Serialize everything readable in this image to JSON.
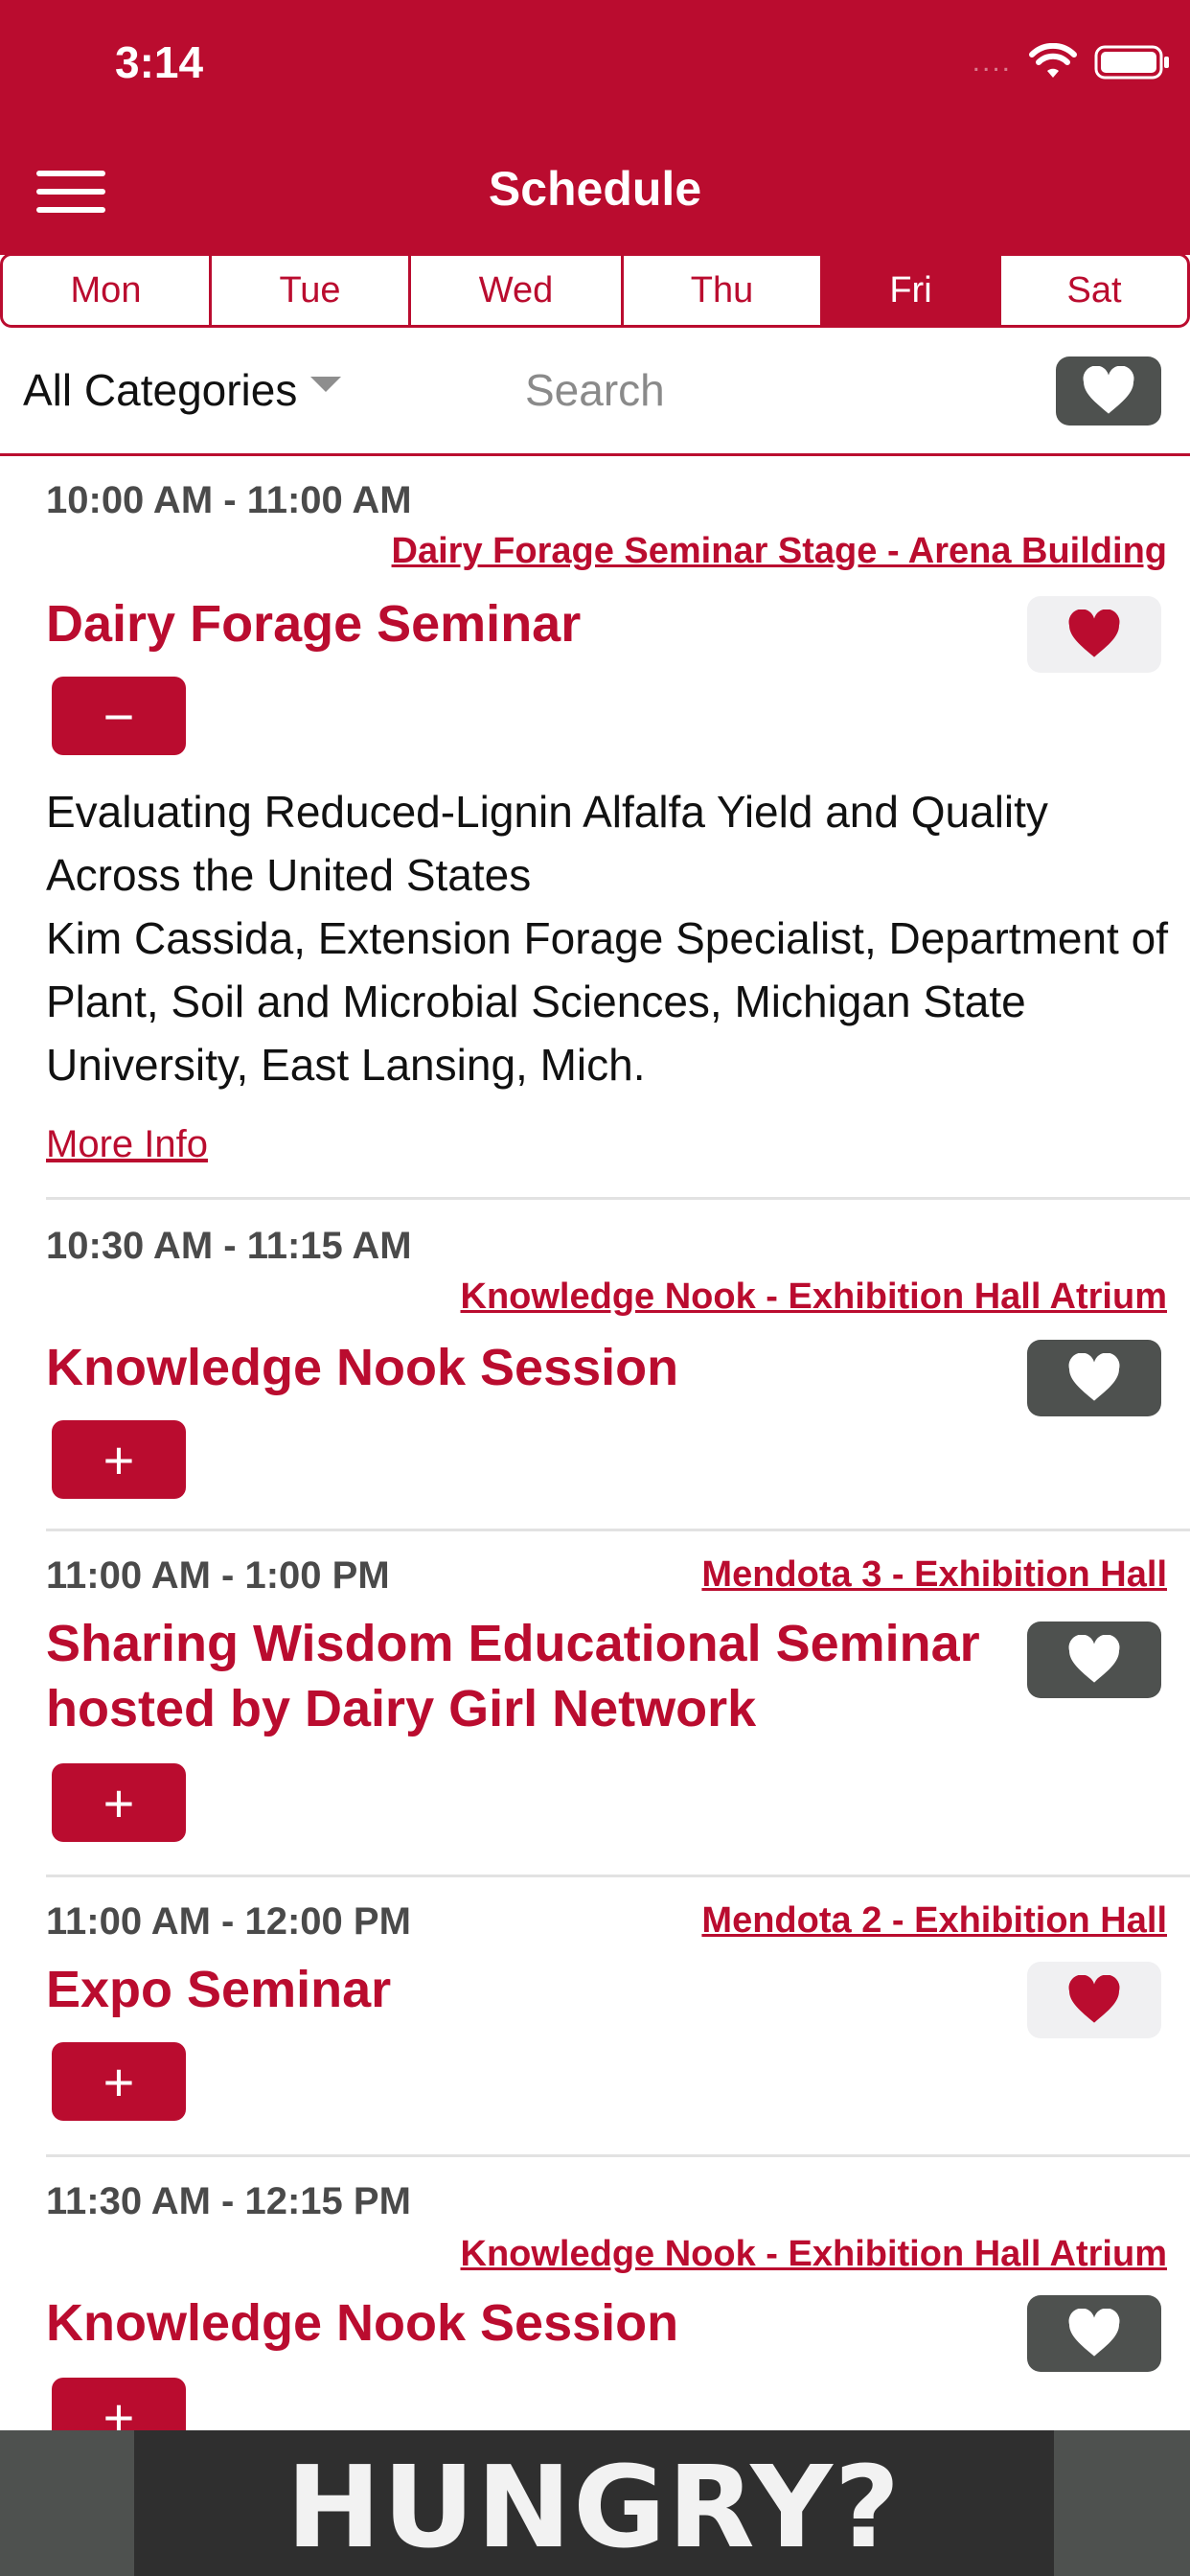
{
  "status_bar": {
    "time": "3:14",
    "signal": "....",
    "wifi_icon": "wifi-icon",
    "battery_icon": "battery-icon"
  },
  "header": {
    "title": "Schedule",
    "menu_icon": "hamburger-menu-icon"
  },
  "days": [
    {
      "label": "Mon",
      "active": false
    },
    {
      "label": "Tue",
      "active": false
    },
    {
      "label": "Wed",
      "active": false
    },
    {
      "label": "Thu",
      "active": false
    },
    {
      "label": "Fri",
      "active": true
    },
    {
      "label": "Sat",
      "active": false
    }
  ],
  "filter": {
    "category": "All Categories",
    "search_placeholder": "Search",
    "favorites_icon": "heart-icon"
  },
  "events": [
    {
      "time": "10:00 AM - 11:00 AM",
      "location": "Dairy Forage Seminar Stage - Arena Building",
      "title_lines": [
        "Dairy Forage Seminar"
      ],
      "favorited": true,
      "expanded": true,
      "toggle": "−",
      "description": "Evaluating Reduced-Lignin Alfalfa Yield and Quality Across the United States",
      "speaker": "Kim Cassida, Extension Forage Specialist, Department of Plant, Soil and Microbial Sciences, Michigan State University, East Lansing, Mich.",
      "more_info": "More Info"
    },
    {
      "time": "10:30 AM - 11:15 AM",
      "location": "Knowledge Nook - Exhibition Hall Atrium",
      "title_lines": [
        "Knowledge Nook Session"
      ],
      "favorited": false,
      "expanded": false,
      "toggle": "+"
    },
    {
      "time": "11:00 AM - 1:00 PM",
      "location": "Mendota 3 - Exhibition Hall",
      "title_lines": [
        "Sharing Wisdom Educational Seminar",
        "hosted by Dairy Girl Network"
      ],
      "favorited": false,
      "expanded": false,
      "toggle": "+"
    },
    {
      "time": "11:00 AM - 12:00 PM",
      "location": "Mendota 2 - Exhibition Hall",
      "title_lines": [
        "Expo Seminar"
      ],
      "favorited": true,
      "expanded": false,
      "toggle": "+"
    },
    {
      "time": "11:30 AM - 12:15 PM",
      "location": "Knowledge Nook - Exhibition Hall Atrium",
      "title_lines": [
        "Knowledge Nook Session"
      ],
      "favorited": false,
      "expanded": false,
      "toggle": "+"
    }
  ],
  "ad": {
    "text": "HUNGRY?"
  },
  "colors": {
    "brand": "#ba0c2f",
    "dark_button": "#4e514f",
    "time_text": "#4a4a4a"
  }
}
